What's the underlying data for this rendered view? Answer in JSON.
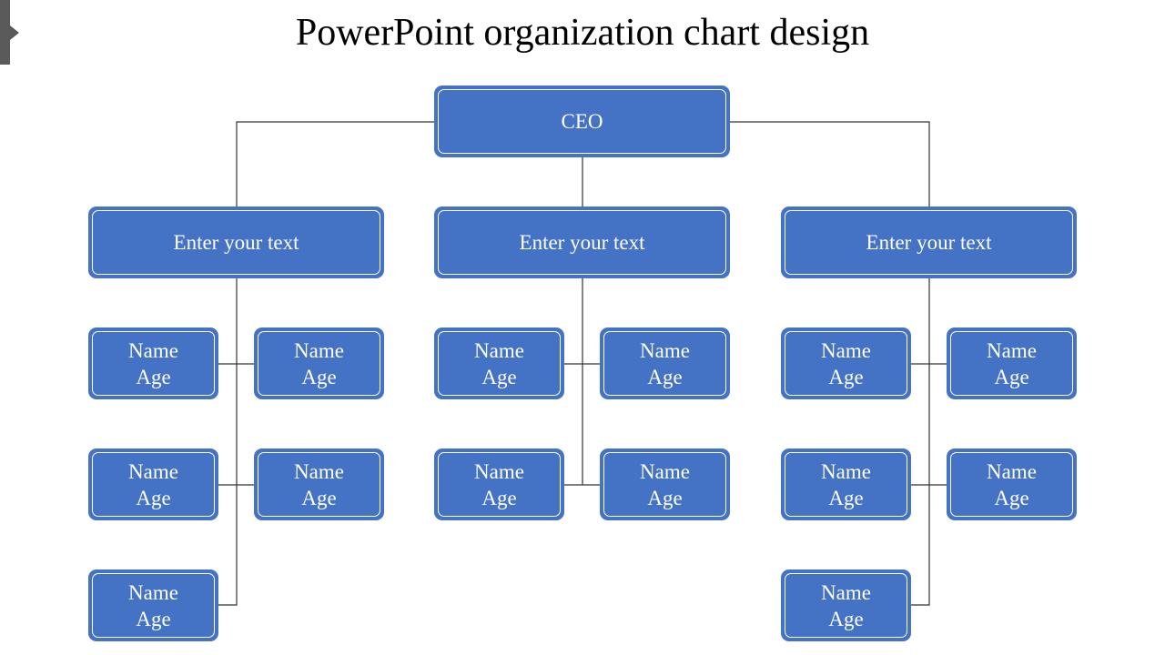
{
  "title": "PowerPoint organization chart design",
  "colors": {
    "box_fill": "#4472C4",
    "box_inner_stroke": "#FFFFFF",
    "connector": "#333333",
    "text": "#FFFFFF"
  },
  "ceo": {
    "label": "CEO"
  },
  "departments": [
    {
      "label": "Enter your text",
      "members": [
        {
          "name": "Name",
          "age": "Age"
        },
        {
          "name": "Name",
          "age": "Age"
        },
        {
          "name": "Name",
          "age": "Age"
        },
        {
          "name": "Name",
          "age": "Age"
        },
        {
          "name": "Name",
          "age": "Age"
        }
      ]
    },
    {
      "label": "Enter your text",
      "members": [
        {
          "name": "Name",
          "age": "Age"
        },
        {
          "name": "Name",
          "age": "Age"
        },
        {
          "name": "Name",
          "age": "Age"
        },
        {
          "name": "Name",
          "age": "Age"
        }
      ]
    },
    {
      "label": "Enter your text",
      "members": [
        {
          "name": "Name",
          "age": "Age"
        },
        {
          "name": "Name",
          "age": "Age"
        },
        {
          "name": "Name",
          "age": "Age"
        },
        {
          "name": "Name",
          "age": "Age"
        },
        {
          "name": "Name",
          "age": "Age"
        }
      ]
    }
  ]
}
